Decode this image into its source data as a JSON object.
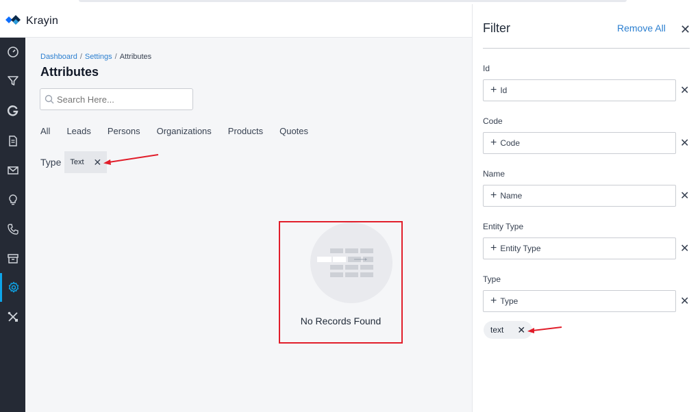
{
  "app": {
    "name": "Krayin"
  },
  "sidebar": {
    "items": [
      {
        "icon": "dashboard-icon"
      },
      {
        "icon": "filter-icon"
      },
      {
        "icon": "g-icon"
      },
      {
        "icon": "document-icon"
      },
      {
        "icon": "mail-icon"
      },
      {
        "icon": "lightbulb-icon"
      },
      {
        "icon": "phone-icon"
      },
      {
        "icon": "archive-icon"
      },
      {
        "icon": "settings-icon",
        "active": true
      },
      {
        "icon": "tools-icon"
      }
    ],
    "accent": "#0ea5e9"
  },
  "breadcrumb": {
    "dashboard": "Dashboard",
    "settings": "Settings",
    "current": "Attributes",
    "separator": "/"
  },
  "page": {
    "title": "Attributes"
  },
  "search": {
    "placeholder": "Search Here..."
  },
  "tabs": [
    "All",
    "Leads",
    "Persons",
    "Organizations",
    "Products",
    "Quotes"
  ],
  "active_filter": {
    "label": "Type",
    "value": "Text"
  },
  "empty_state": {
    "message": "No Records Found"
  },
  "filter_panel": {
    "title": "Filter",
    "remove_all": "Remove All",
    "fields": [
      {
        "label": "Id",
        "placeholder": "Id"
      },
      {
        "label": "Code",
        "placeholder": "Code"
      },
      {
        "label": "Name",
        "placeholder": "Name"
      },
      {
        "label": "Entity Type",
        "placeholder": "Entity Type"
      },
      {
        "label": "Type",
        "placeholder": "Type"
      }
    ],
    "applied_value": "text"
  },
  "colors": {
    "link": "#2b7fd0",
    "annotation": "#e11d2a",
    "sidebar_bg": "#252a35"
  }
}
